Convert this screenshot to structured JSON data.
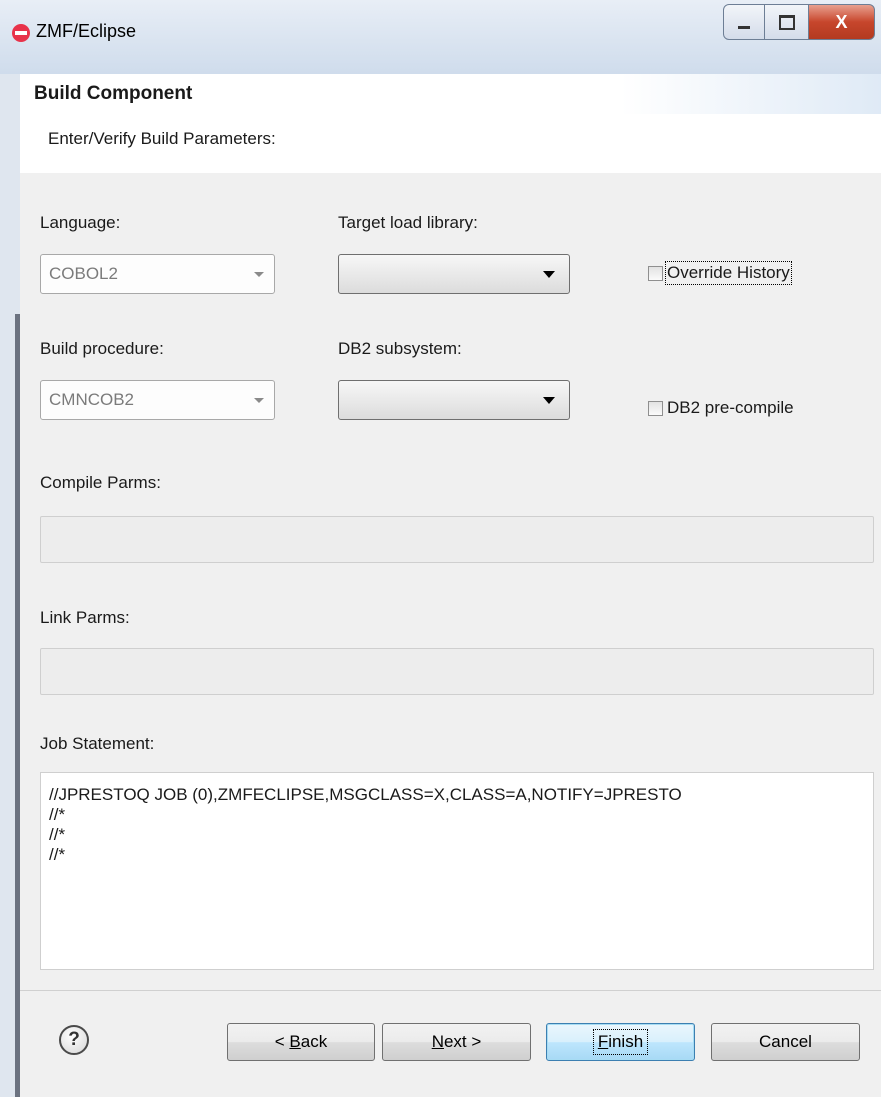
{
  "window": {
    "title": "ZMF/Eclipse",
    "close_glyph": "X"
  },
  "header": {
    "title": "Build Component",
    "subtitle": "Enter/Verify Build Parameters:"
  },
  "form": {
    "language_label": "Language:",
    "language_value": "COBOL2",
    "target_load_library_label": "Target load library:",
    "target_load_library_value": "",
    "override_history_label": "Override History",
    "override_history_checked": false,
    "build_procedure_label": "Build procedure:",
    "build_procedure_value": "CMNCOB2",
    "db2_subsystem_label": "DB2 subsystem:",
    "db2_subsystem_value": "",
    "db2_precompile_label": "DB2 pre-compile",
    "db2_precompile_checked": false,
    "compile_parms_label": "Compile Parms:",
    "compile_parms_value": "",
    "link_parms_label": "Link Parms:",
    "link_parms_value": "",
    "job_statement_label": "Job Statement:",
    "job_statement_lines": [
      "//JPRESTOQ JOB (0),ZMFECLIPSE,MSGCLASS=X,CLASS=A,NOTIFY=JPRESTO",
      "//*",
      "//*",
      "//*"
    ]
  },
  "buttons": {
    "help_glyph": "?",
    "back_prefix": "< ",
    "back_mnemonic": "B",
    "back_rest": "ack",
    "next_mnemonic": "N",
    "next_rest": "ext >",
    "finish_mnemonic": "F",
    "finish_rest": "inish",
    "cancel": "Cancel"
  },
  "icons": {
    "app": "zmf-app-icon",
    "help": "help-icon",
    "dropdown": "chevron-down-icon"
  }
}
